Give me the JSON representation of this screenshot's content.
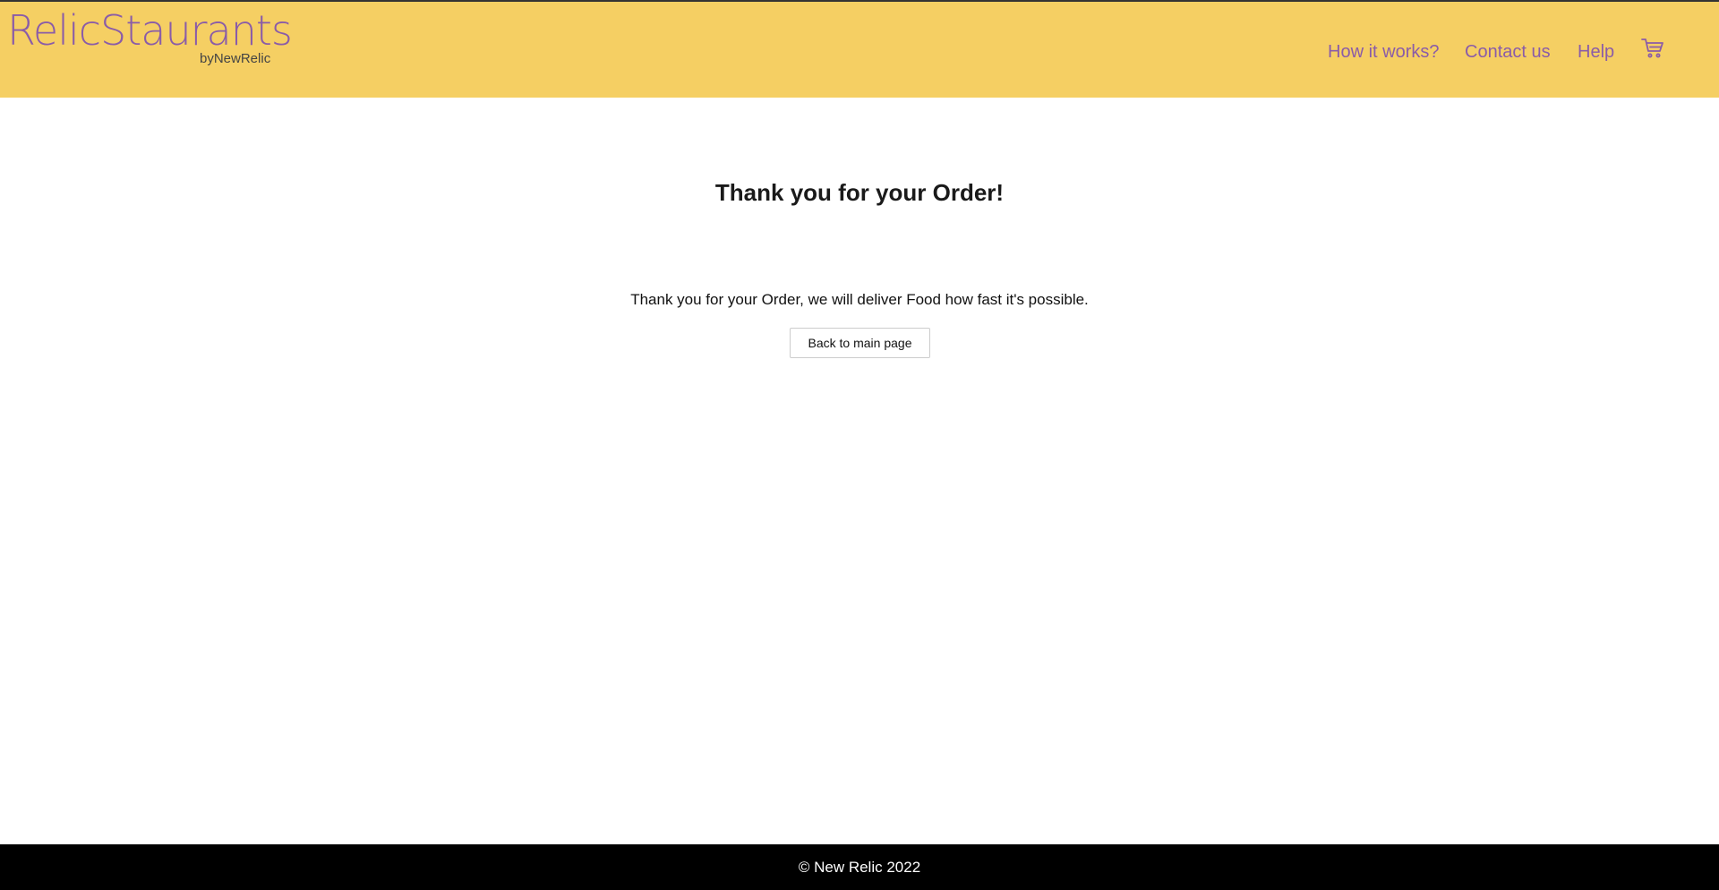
{
  "header": {
    "brand": {
      "name": "RelicStaurants",
      "byline": "byNewRelic"
    },
    "nav": [
      {
        "label": "How it works?"
      },
      {
        "label": "Contact us"
      },
      {
        "label": "Help"
      }
    ],
    "cart_icon": "shopping-cart-icon"
  },
  "main": {
    "title": "Thank you for your Order!",
    "message": "Thank you for your Order, we will deliver Food how fast it's possible.",
    "back_button_label": "Back to main page"
  },
  "footer": {
    "text": "© New Relic 2022"
  },
  "colors": {
    "header_bg": "#f5cf63",
    "accent": "#8a5ca8",
    "footer_bg": "#000000",
    "footer_text": "#ffffff"
  }
}
